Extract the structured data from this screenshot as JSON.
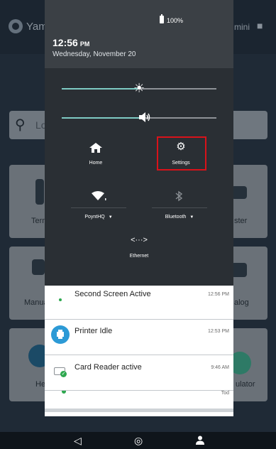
{
  "background_app": {
    "brand": "Yam",
    "user_name": "mini",
    "search_placeholder": "Lo",
    "tiles": [
      {
        "label": "Term",
        "icon": "terminal-icon"
      },
      {
        "label": "ster",
        "icon": "register-icon"
      },
      {
        "label": "Manua",
        "icon": "manual-icon"
      },
      {
        "label": "alog",
        "icon": "catalog-icon"
      },
      {
        "label": "He",
        "icon": "help-icon"
      },
      {
        "label": "ulator",
        "icon": "calculator-icon"
      }
    ]
  },
  "status": {
    "battery_percent": "100%",
    "time": "12:56",
    "ampm": "PM",
    "date": "Wednesday, November 20"
  },
  "quick_settings": {
    "brightness_level": 0.5,
    "volume_level": 0.52,
    "accent_color": "#7fcbc4",
    "tiles": {
      "home": {
        "label": "Home",
        "icon": "home-icon"
      },
      "settings": {
        "label": "Settings",
        "icon": "gear-icon",
        "highlight_color": "#d9121a"
      },
      "wifi": {
        "label": "PoyntHQ",
        "icon": "wifi-icon"
      },
      "bluetooth": {
        "label": "Bluetooth",
        "icon": "bluetooth-icon"
      },
      "ethernet": {
        "label": "Ethernet",
        "icon": "ethernet-icon"
      }
    }
  },
  "notifications": [
    {
      "title": "Second Screen Active",
      "time": "12:56 PM"
    },
    {
      "title": "Printer Idle",
      "time": "12:53 PM"
    },
    {
      "title": "Card Reader active",
      "time": "9:46 AM"
    }
  ],
  "peek_time": "Tod",
  "nav": {
    "back": "◁",
    "home": "◎",
    "profile": "person-icon"
  }
}
